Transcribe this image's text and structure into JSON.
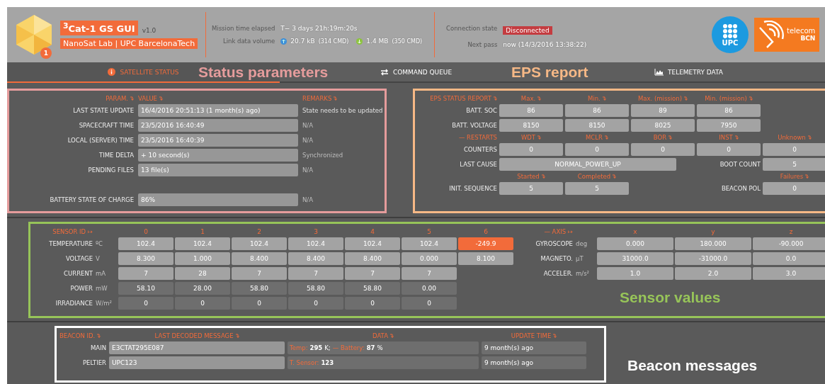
{
  "header": {
    "title": "$^{3}$Cat-1 GS GUI",
    "version": "v1.0",
    "subtitle": "NanoSat Lab | UPC BarcelonaTech",
    "badge": "1",
    "mission": {
      "elapsed_label": "Mission time elapsed",
      "elapsed": "T− 3 days 21h:19m:20s",
      "volume_label": "Link data volume",
      "up": "20.7 kB",
      "up_cmd": "(314 CMD)",
      "down": "1.4 MB",
      "down_cmd": "(350 CMD)"
    },
    "connection": {
      "state_label": "Connection state",
      "state": "Disconnected",
      "connected": false,
      "pass_label": "Next pass",
      "pass": "now (14/3/2016 13:38:22)"
    },
    "logos": {
      "upc": "UPC",
      "telecom": "telecom",
      "bcn": "BCN"
    }
  },
  "tabs": [
    {
      "label": "SATELLITE STATUS",
      "selected": true,
      "kind": "info"
    },
    {
      "label": "COMMAND QUEUE",
      "selected": false,
      "kind": "queue"
    },
    {
      "label": "TELEMETRY DATA",
      "selected": false,
      "kind": "chart"
    }
  ],
  "status_panel": {
    "annotation": "Status parameters",
    "color": "#e59c9c",
    "columns": [
      "PARAM.",
      "VALUE",
      "REMARKS"
    ],
    "rows": [
      {
        "param": "LAST STATE UPDATE",
        "value": "16/4/2016 20:51:13 (1 month(s) ago)",
        "remark": "State needs to be updated",
        "stale": true
      },
      {
        "param": "SPACECRAFT TIME",
        "value": "23/5/2016 16:40:49",
        "remark": "N/A",
        "stale": false
      },
      {
        "param": "LOCAL (SERVER) TIME",
        "value": "23/5/2016 16:40:39",
        "remark": "N/A",
        "stale": false
      },
      {
        "param": "TIME DELTA",
        "value": "+ 10 second(s)",
        "remark": "Synchronized",
        "stale": false
      },
      {
        "param": "PENDING FILES",
        "value": "13 file(s)",
        "remark": "N/A",
        "stale": false
      }
    ],
    "footer_row": {
      "param": "BATTERY STATE OF CHARGE",
      "value": "86%",
      "remark": "N/A",
      "stale": false
    }
  },
  "eps_panel": {
    "annotation": "EPS report",
    "color": "#f6b886",
    "title": "EPS STATUS REPORT",
    "columns": [
      "Max.",
      "Min.",
      "Max. (mission)",
      "Min. (mission)"
    ],
    "rows": [
      {
        "label": "BATT. SOC",
        "values": [
          "86",
          "86",
          "89",
          "86"
        ]
      },
      {
        "label": "BATT. VOLTAGE",
        "values": [
          "8150",
          "8150",
          "8025",
          "7950"
        ]
      }
    ],
    "restarts": {
      "title": "— RESTARTS",
      "columns": [
        "WDT",
        "MCLR",
        "BOR",
        "INST",
        "Unknown"
      ],
      "label": "COUNTERS",
      "values": [
        "0",
        "0",
        "0",
        "0",
        "0"
      ]
    },
    "last_cause": {
      "label": "LAST CAUSE",
      "value": "NORMAL_POWER_UP"
    },
    "boot_count": {
      "label": "BOOT COUNT",
      "value": "5"
    },
    "init": {
      "columns": [
        "Started",
        "Completed"
      ],
      "label": "INIT. SEQUENCE",
      "values": [
        "5",
        "5"
      ]
    },
    "beacon_pol": {
      "column": "Failures",
      "label": "BEACON POL",
      "value": "0"
    }
  },
  "sensor_panel": {
    "annotation": "Sensor values",
    "color": "#97c459",
    "id_label": "SENSOR ID ↦",
    "ids": [
      "0",
      "1",
      "2",
      "3",
      "4",
      "5",
      "6"
    ],
    "sensors": [
      {
        "name": "TEMPERATURE",
        "unit": "ºC",
        "kind": "light",
        "cells": [
          {
            "value": "102.4",
            "alarm": false
          },
          {
            "value": "102.4",
            "alarm": false
          },
          {
            "value": "102.4",
            "alarm": false
          },
          {
            "value": "102.4",
            "alarm": false
          },
          {
            "value": "102.4",
            "alarm": false
          },
          {
            "value": "102.4",
            "alarm": false
          },
          {
            "value": "-249.9",
            "alarm": true
          }
        ]
      },
      {
        "name": "VOLTAGE",
        "unit": "V",
        "kind": "light",
        "cells": [
          {
            "value": "8.300",
            "alarm": false
          },
          {
            "value": "1.000",
            "alarm": false
          },
          {
            "value": "8.400",
            "alarm": false
          },
          {
            "value": "8.400",
            "alarm": false
          },
          {
            "value": "8.400",
            "alarm": false
          },
          {
            "value": "0.000",
            "alarm": false
          },
          {
            "value": "8.100",
            "alarm": false
          }
        ]
      },
      {
        "name": "CURRENT",
        "unit": "mA",
        "kind": "light",
        "cells": [
          {
            "value": "7",
            "alarm": false
          },
          {
            "value": "28",
            "alarm": false
          },
          {
            "value": "7",
            "alarm": false
          },
          {
            "value": "7",
            "alarm": false
          },
          {
            "value": "7",
            "alarm": false
          },
          {
            "value": "7",
            "alarm": false
          }
        ]
      },
      {
        "name": "POWER",
        "unit": "mW",
        "kind": "dark",
        "cells": [
          {
            "value": "58.10",
            "alarm": false
          },
          {
            "value": "28.00",
            "alarm": false
          },
          {
            "value": "58.80",
            "alarm": false
          },
          {
            "value": "58.80",
            "alarm": false
          },
          {
            "value": "58.80",
            "alarm": false
          },
          {
            "value": "0.00",
            "alarm": false
          }
        ]
      },
      {
        "name": "IRRADIANCE",
        "unit": "W/m²",
        "kind": "dark",
        "cells": [
          {
            "value": "0",
            "alarm": false
          },
          {
            "value": "0",
            "alarm": false
          },
          {
            "value": "0",
            "alarm": false
          },
          {
            "value": "0",
            "alarm": false
          },
          {
            "value": "0",
            "alarm": false
          },
          {
            "value": "0",
            "alarm": false
          }
        ]
      }
    ],
    "axis_label": "— AXIS ↦",
    "axes": [
      "x",
      "y",
      "z"
    ],
    "imu": [
      {
        "name": "GYROSCOPE",
        "unit": "deg",
        "values": [
          "0.000",
          "180.000",
          "-90.000"
        ]
      },
      {
        "name": "MAGNETO.",
        "unit": "µT",
        "values": [
          "31000.0",
          "-31000.0",
          "0.0"
        ]
      },
      {
        "name": "ACCELER.",
        "unit": "m/s²",
        "values": [
          "1.0",
          "2.0",
          "3.0"
        ]
      }
    ]
  },
  "beacon_panel": {
    "annotation": "Beacon messages",
    "color": "#ffffff",
    "columns": [
      "BEACON ID.",
      "LAST DECODED MESSAGE",
      "DATA",
      "UPDATE TIME"
    ],
    "rows": [
      {
        "id": "MAIN",
        "message": "E3CTAT295E087",
        "data": [
          {
            "label": "Temp:",
            "value": "295",
            "unit": "K;"
          },
          {
            "label": "— Battery:",
            "value": "87",
            "unit": "%"
          }
        ],
        "time": "9 month(s) ago"
      },
      {
        "id": "PELTIER",
        "message": "UPC123",
        "data": [
          {
            "label": "T. Sensor:",
            "value": "123"
          }
        ],
        "time": "9 month(s) ago"
      }
    ]
  }
}
